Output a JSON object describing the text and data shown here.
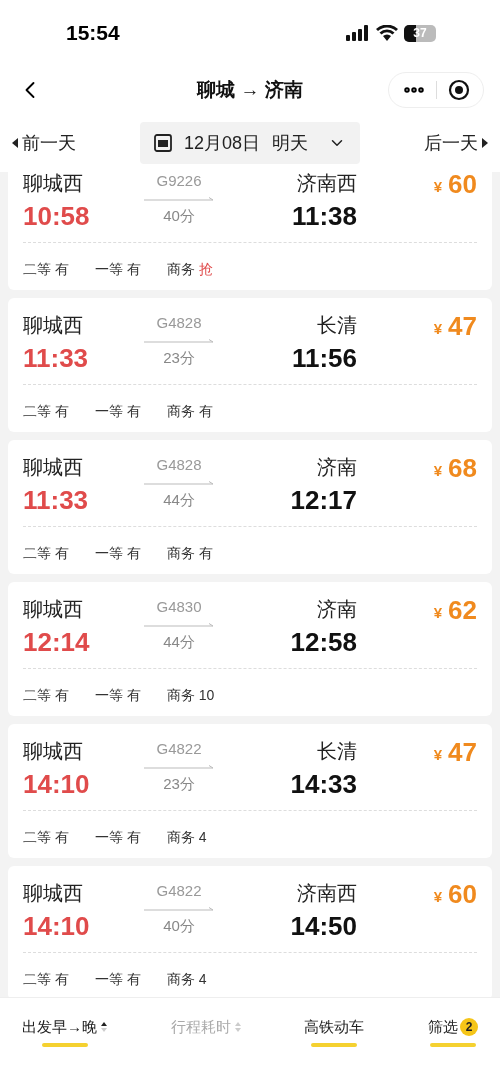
{
  "status_bar": {
    "time": "15:54",
    "battery": "37"
  },
  "nav": {
    "title": "聊城 → 济南"
  },
  "date_bar": {
    "prev": "前一天",
    "date": "12月08日",
    "day": "明天",
    "next": "后一天"
  },
  "trains": [
    {
      "from": "聊城西",
      "depart": "10:58",
      "number": "G9226",
      "duration": "40分",
      "to": "济南西",
      "arrive": "11:38",
      "currency": "¥",
      "price": "60",
      "seats": [
        {
          "class": "二等",
          "avail": "有",
          "urgent": false
        },
        {
          "class": "一等",
          "avail": "有",
          "urgent": false
        },
        {
          "class": "商务",
          "avail": "抢",
          "urgent": true
        }
      ]
    },
    {
      "from": "聊城西",
      "depart": "11:33",
      "number": "G4828",
      "duration": "23分",
      "to": "长清",
      "arrive": "11:56",
      "currency": "¥",
      "price": "47",
      "seats": [
        {
          "class": "二等",
          "avail": "有",
          "urgent": false
        },
        {
          "class": "一等",
          "avail": "有",
          "urgent": false
        },
        {
          "class": "商务",
          "avail": "有",
          "urgent": false
        }
      ]
    },
    {
      "from": "聊城西",
      "depart": "11:33",
      "number": "G4828",
      "duration": "44分",
      "to": "济南",
      "arrive": "12:17",
      "currency": "¥",
      "price": "68",
      "seats": [
        {
          "class": "二等",
          "avail": "有",
          "urgent": false
        },
        {
          "class": "一等",
          "avail": "有",
          "urgent": false
        },
        {
          "class": "商务",
          "avail": "有",
          "urgent": false
        }
      ]
    },
    {
      "from": "聊城西",
      "depart": "12:14",
      "number": "G4830",
      "duration": "44分",
      "to": "济南",
      "arrive": "12:58",
      "currency": "¥",
      "price": "62",
      "seats": [
        {
          "class": "二等",
          "avail": "有",
          "urgent": false
        },
        {
          "class": "一等",
          "avail": "有",
          "urgent": false
        },
        {
          "class": "商务",
          "avail": "10",
          "urgent": false
        }
      ]
    },
    {
      "from": "聊城西",
      "depart": "14:10",
      "number": "G4822",
      "duration": "23分",
      "to": "长清",
      "arrive": "14:33",
      "currency": "¥",
      "price": "47",
      "seats": [
        {
          "class": "二等",
          "avail": "有",
          "urgent": false
        },
        {
          "class": "一等",
          "avail": "有",
          "urgent": false
        },
        {
          "class": "商务",
          "avail": "4",
          "urgent": false
        }
      ]
    },
    {
      "from": "聊城西",
      "depart": "14:10",
      "number": "G4822",
      "duration": "40分",
      "to": "济南西",
      "arrive": "14:50",
      "currency": "¥",
      "price": "60",
      "seats": [
        {
          "class": "二等",
          "avail": "有",
          "urgent": false
        },
        {
          "class": "一等",
          "avail": "有",
          "urgent": false
        },
        {
          "class": "商务",
          "avail": "4",
          "urgent": false
        }
      ]
    }
  ],
  "bottom_tabs": [
    {
      "label": "出发早→晚",
      "selected": true,
      "kind": "sort_asc"
    },
    {
      "label": "行程耗时",
      "selected": false,
      "kind": "sort"
    },
    {
      "label": "高铁动车",
      "selected": true,
      "kind": "toggle"
    },
    {
      "label": "筛选",
      "selected": true,
      "kind": "filter",
      "badge": "2"
    }
  ]
}
